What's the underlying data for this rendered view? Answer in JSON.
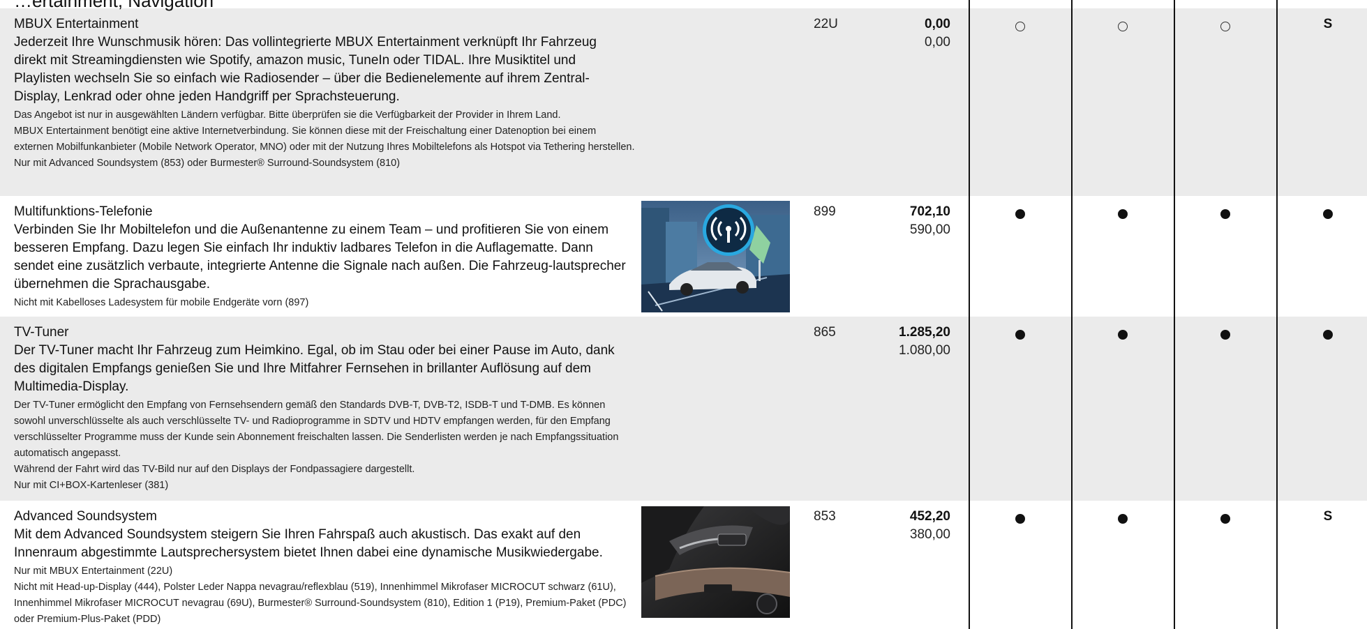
{
  "heading_fragment": "…ertainment, Navigation",
  "rows": [
    {
      "title": "MBUX Entertainment",
      "body": "Jederzeit Ihre Wunschmusik hören: Das vollintegrierte MBUX Entertainment verknüpft Ihr Fahrzeug direkt mit Streamingdiensten wie Spotify, amazon music, TuneIn oder TIDAL. Ihre Musiktitel und Playlisten wechseln Sie so einfach wie Radiosender – über die Bedienelemente auf ihrem Zentral-Display, Lenkrad oder ohne jeden Handgriff per Sprachsteuerung.",
      "notes": [
        "Das Angebot ist nur in ausgewählten Ländern verfügbar. Bitte überprüfen sie die Verfügbarkeit der Provider in Ihrem Land.",
        "MBUX Entertainment benötigt eine aktive Internetverbindung. Sie können diese mit der Freischaltung einer Datenoption bei einem externen Mobilfunkanbieter (Mobile Network Operator, MNO) oder mit der Nutzung Ihres Mobiltelefons als Hotspot via Tethering herstellen.",
        "Nur mit Advanced Soundsystem (853) oder Burmester® Surround-Soundsystem (810)"
      ],
      "code": "22U",
      "price_gross": "0,00",
      "price_net": "0,00",
      "marks": [
        "circle",
        "circle",
        "circle",
        "S"
      ]
    },
    {
      "title": "Multifunktions-Telefonie",
      "body": "Verbinden Sie Ihr Mobiltelefon und die Außenantenne zu einem Team – und profitieren Sie von einem besseren Empfang. Dazu legen Sie einfach Ihr induktiv ladbares Telefon in die Auflagematte. Dann sendet eine zusätzlich verbaute, integrierte Antenne die Signale nach außen. Die Fahrzeug-lautsprecher übernehmen die Sprachausgabe.",
      "notes": [
        "Nicht mit Kabelloses Ladesystem für mobile Endgeräte vorn (897)"
      ],
      "code": "899",
      "price_gross": "702,10",
      "price_net": "590,00",
      "marks": [
        "dot",
        "dot",
        "dot",
        "dot"
      ]
    },
    {
      "title": "TV-Tuner",
      "body": "Der TV-Tuner macht Ihr Fahrzeug zum Heimkino. Egal, ob im Stau oder bei einer Pause im Auto, dank des digitalen Empfangs genießen Sie und Ihre Mitfahrer Fernsehen in brillanter Auflösung auf dem Multimedia-Display.",
      "notes": [
        "Der TV-Tuner ermöglicht den Empfang von Fernsehsendern gemäß den Standards DVB-T, DVB-T2, ISDB-T und T-DMB. Es können sowohl unverschlüsselte als auch verschlüsselte TV- und Radioprogramme in SDTV und HDTV empfangen werden, für den Empfang verschlüsselter Programme muss der Kunde sein Abonnement freischalten lassen. Die Senderlisten werden je nach Empfangssituation automatisch angepasst.",
        "Während der Fahrt wird das TV-Bild nur auf den Displays der Fondpassagiere dargestellt.",
        "Nur mit CI+BOX-Kartenleser (381)"
      ],
      "code": "865",
      "price_gross": "1.285,20",
      "price_net": "1.080,00",
      "marks": [
        "dot",
        "dot",
        "dot",
        "dot"
      ]
    },
    {
      "title": "Advanced Soundsystem",
      "body": "Mit dem Advanced Soundsystem steigern Sie Ihren Fahrspaß auch akustisch. Das exakt auf den Innenraum abgestimmte Lautsprechersystem bietet Ihnen dabei eine dynamische Musikwiedergabe.",
      "notes": [
        "Nur mit MBUX Entertainment (22U)",
        "Nicht mit Head-up-Display (444), Polster Leder Nappa nevagrau/reflexblau (519), Innenhimmel Mikrofaser MICROCUT schwarz (61U), Innenhimmel Mikrofaser MICROCUT nevagrau (69U), Burmester® Surround-Soundsystem (810), Edition 1 (P19), Premium-Paket (PDC) oder Premium-Plus-Paket (PDD)"
      ],
      "code": "853",
      "price_gross": "452,20",
      "price_net": "380,00",
      "marks": [
        "dot",
        "dot",
        "dot",
        "S"
      ]
    }
  ]
}
